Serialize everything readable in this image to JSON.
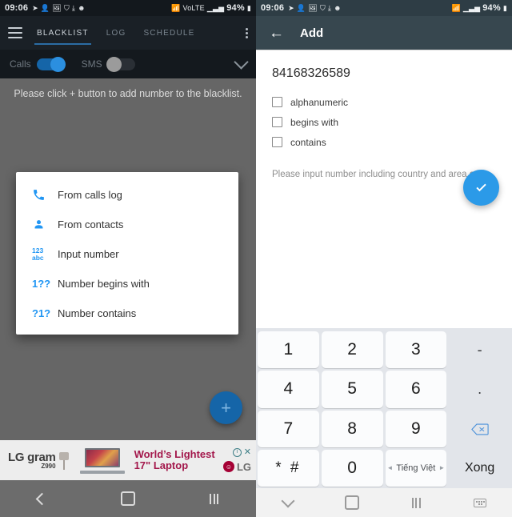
{
  "left": {
    "status_bar": {
      "time": "09:06",
      "icons": [
        "send-icon",
        "contact-sync-icon",
        "image-icon",
        "shield-icon",
        "download-icon",
        "emoji-icon"
      ],
      "wifi": "wifi-icon",
      "network": "VoLTE",
      "signal": "signal-icon",
      "battery_pct": "94%"
    },
    "appbar": {
      "menu_icon": "hamburger-icon",
      "overflow_icon": "kebab-menu-icon",
      "tabs": [
        {
          "label": "BLACKLIST",
          "active": true
        },
        {
          "label": "LOG",
          "active": false
        },
        {
          "label": "SCHEDULE",
          "active": false
        }
      ]
    },
    "filters": {
      "calls_label": "Calls",
      "calls_on": true,
      "sms_label": "SMS",
      "sms_on": false,
      "expand_icon": "chevron-down-icon"
    },
    "empty_hint": "Please click + button to add number to the blacklist.",
    "dialog": {
      "items": [
        {
          "icon": "phone-icon",
          "label": "From calls log"
        },
        {
          "icon": "person-icon",
          "label": "From contacts"
        },
        {
          "icon": "123abc-icon",
          "icon_line1": "123",
          "icon_line2": "abc",
          "label": "Input number"
        },
        {
          "icon": "begins-with-icon",
          "icon_text": "1??",
          "label": "Number begins with"
        },
        {
          "icon": "contains-icon",
          "icon_text": "?1?",
          "label": "Number contains"
        }
      ]
    },
    "fab": {
      "icon": "plus-icon",
      "label": "+"
    },
    "ad": {
      "brand_line1": "LG gram",
      "brand_line2": "Z990",
      "headline_line1": "World’s Lightest",
      "headline_line2": "17\" Laptop",
      "info_icon": "ad-info-icon",
      "close_icon": "ad-close-icon",
      "logo_text": "LG"
    },
    "navbar": {
      "back": "back-icon",
      "home": "home-icon",
      "recents": "recents-icon"
    }
  },
  "right": {
    "status_bar": {
      "time": "09:06",
      "battery_pct": "94%"
    },
    "appbar": {
      "back_icon": "back-arrow-icon",
      "title": "Add"
    },
    "number_value": "84168326589",
    "checkboxes": [
      {
        "label": "alphanumeric",
        "checked": false
      },
      {
        "label": "begins with",
        "checked": false
      },
      {
        "label": "contains",
        "checked": false
      }
    ],
    "help_text": "Please input number including country and area code.",
    "confirm_fab": {
      "icon": "check-icon"
    },
    "keyboard": {
      "rows": [
        [
          {
            "label": "1",
            "type": "key"
          },
          {
            "label": "2",
            "type": "key"
          },
          {
            "label": "3",
            "type": "key"
          },
          {
            "label": "-",
            "type": "flat"
          }
        ],
        [
          {
            "label": "4",
            "type": "key"
          },
          {
            "label": "5",
            "type": "key"
          },
          {
            "label": "6",
            "type": "key"
          },
          {
            "label": ".",
            "type": "flat"
          }
        ],
        [
          {
            "label": "7",
            "type": "key"
          },
          {
            "label": "8",
            "type": "key"
          },
          {
            "label": "9",
            "type": "key"
          },
          {
            "label": "backspace-icon",
            "type": "backspace"
          }
        ],
        [
          {
            "label": "* #",
            "type": "key"
          },
          {
            "label": "0",
            "type": "key"
          },
          {
            "label": "Tiếng Việt",
            "type": "lang"
          },
          {
            "label": "Xong",
            "type": "flat-done"
          }
        ]
      ]
    },
    "navbar": {
      "hide_keyboard": "chevron-down-icon",
      "home": "home-icon",
      "recents": "recents-icon",
      "keyboard": "keyboard-icon"
    }
  }
}
